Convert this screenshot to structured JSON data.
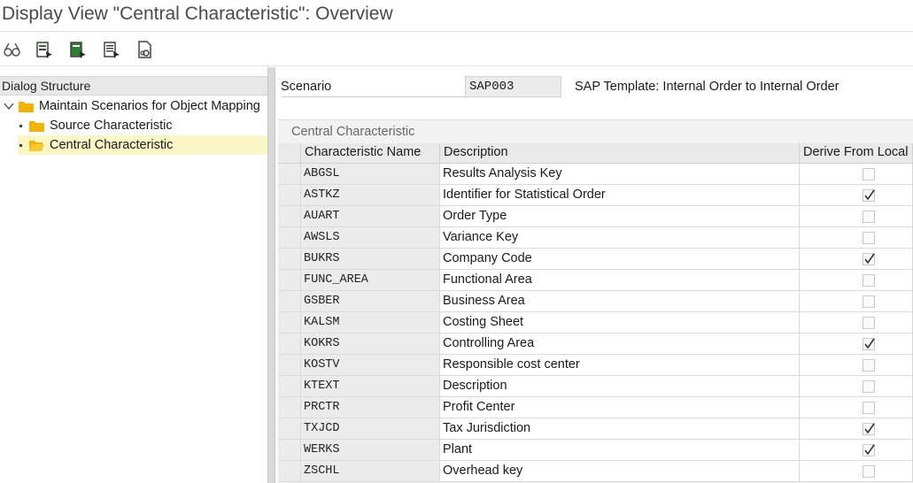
{
  "window": {
    "title": "Display View \"Central Characteristic\": Overview"
  },
  "toolbar": {
    "buttons": [
      {
        "icon": "glasses-icon"
      },
      {
        "icon": "table-select-icon"
      },
      {
        "icon": "table-select-all-icon"
      },
      {
        "icon": "table-deselect-icon"
      },
      {
        "icon": "document-print-icon"
      }
    ]
  },
  "dialog_structure": {
    "header": "Dialog Structure",
    "root": "Maintain Scenarios for Object Mapping",
    "children": [
      {
        "label": "Source Characteristic",
        "selected": false
      },
      {
        "label": "Central Characteristic",
        "selected": true
      }
    ]
  },
  "scenario": {
    "label": "Scenario",
    "value": "SAP003",
    "description": "SAP Template: Internal Order to Internal Order"
  },
  "table": {
    "title": "Central Characteristic",
    "columns": [
      "Characteristic Name",
      "Description",
      "Derive From Local"
    ],
    "rows": [
      {
        "name": "ABGSL",
        "description": "Results Analysis Key",
        "derive": false
      },
      {
        "name": "ASTKZ",
        "description": "Identifier for Statistical Order",
        "derive": true
      },
      {
        "name": "AUART",
        "description": "Order Type",
        "derive": false
      },
      {
        "name": "AWSLS",
        "description": "Variance Key",
        "derive": false
      },
      {
        "name": "BUKRS",
        "description": "Company Code",
        "derive": true
      },
      {
        "name": "FUNC_AREA",
        "description": "Functional Area",
        "derive": false
      },
      {
        "name": "GSBER",
        "description": "Business Area",
        "derive": false
      },
      {
        "name": "KALSM",
        "description": "Costing Sheet",
        "derive": false
      },
      {
        "name": "KOKRS",
        "description": "Controlling Area",
        "derive": true
      },
      {
        "name": "KOSTV",
        "description": "Responsible cost center",
        "derive": false
      },
      {
        "name": "KTEXT",
        "description": "Description",
        "derive": false
      },
      {
        "name": "PRCTR",
        "description": "Profit Center",
        "derive": false
      },
      {
        "name": "TXJCD",
        "description": "Tax Jurisdiction",
        "derive": true
      },
      {
        "name": "WERKS",
        "description": "Plant",
        "derive": true
      },
      {
        "name": "ZSCHL",
        "description": "Overhead key",
        "derive": false
      }
    ]
  },
  "colors": {
    "selected_row": "#fbf6c6",
    "folder": "#f2b200",
    "splitter": "#d9d9d9"
  }
}
